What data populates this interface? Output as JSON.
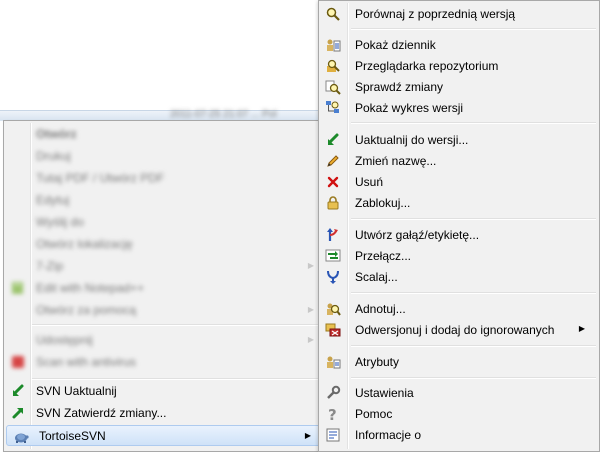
{
  "background": {
    "timestamp_fragment": "2011-07-25 21:07 ... Pol",
    "blurred_note": "obscured explorer content"
  },
  "left_menu": {
    "blurred_items": [
      "Otwórz",
      "Drukuj",
      "Tutaj PDF / Utwórz PDF",
      "Edytuj",
      "Wyślij do",
      "Otwórz lokalizację",
      "7-Zip",
      "Edit with Notepad++",
      "Otwórz za pomocą",
      "Udostępnij",
      "Scan with antivirus"
    ],
    "svn_update": "SVN Uaktualnij",
    "svn_commit": "SVN Zatwierdź zmiany...",
    "tortoise": "TortoiseSVN"
  },
  "submenu": {
    "items": [
      {
        "label": "Porównaj z poprzednią wersją",
        "icon": "diff-magnifier-icon"
      },
      {
        "label": "Pokaż dziennik",
        "icon": "log-icon"
      },
      {
        "label": "Przeglądarka repozytorium",
        "icon": "repo-browser-icon"
      },
      {
        "label": "Sprawdź zmiany",
        "icon": "check-modifications-icon"
      },
      {
        "label": "Pokaż wykres wersji",
        "icon": "revision-graph-icon"
      },
      {
        "label": "Uaktualnij do wersji...",
        "icon": "update-to-revision-icon"
      },
      {
        "label": "Zmień nazwę...",
        "icon": "rename-pencil-icon"
      },
      {
        "label": "Usuń",
        "icon": "delete-x-icon"
      },
      {
        "label": "Zablokuj...",
        "icon": "lock-icon"
      },
      {
        "label": "Utwórz gałąź/etykietę...",
        "icon": "branch-tag-icon"
      },
      {
        "label": "Przełącz...",
        "icon": "switch-icon"
      },
      {
        "label": "Scalaj...",
        "icon": "merge-icon"
      },
      {
        "label": "Adnotuj...",
        "icon": "blame-icon"
      },
      {
        "label": "Odwersjonuj i dodaj do ignorowanych",
        "icon": "ignore-icon"
      },
      {
        "label": "Atrybuty",
        "icon": "properties-icon"
      },
      {
        "label": "Ustawienia",
        "icon": "settings-icon"
      },
      {
        "label": "Pomoc",
        "icon": "help-icon"
      },
      {
        "label": "Informacje o",
        "icon": "about-icon"
      }
    ]
  },
  "colors": {
    "menu_bg": "#f1f1f1",
    "hover_bg": "#cfe2f8",
    "delete_red": "#d01010",
    "update_green": "#1c8a2a"
  }
}
